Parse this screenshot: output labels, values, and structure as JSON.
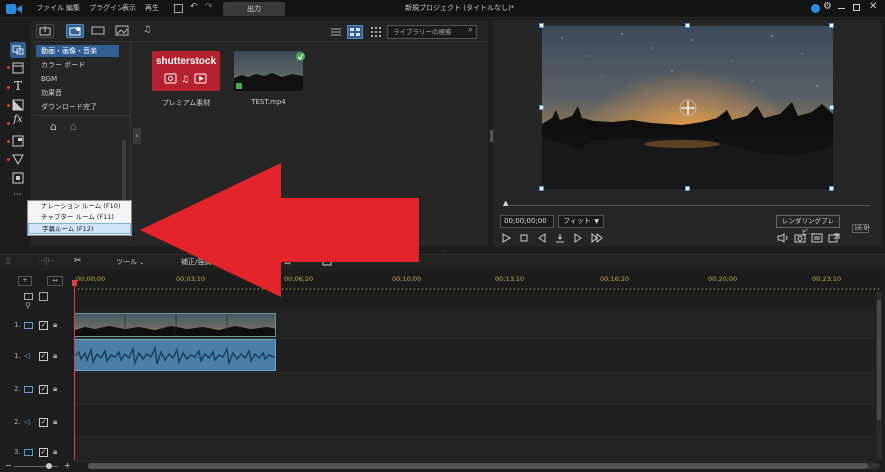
{
  "menubar": {
    "items": [
      "ファイル",
      "編集",
      "プラグイン",
      "表示",
      "再生"
    ],
    "export_tab": "出力",
    "window_title": "新規プロジェクト (タイトルなし)*"
  },
  "library": {
    "search_placeholder": "ライブラリーの検索",
    "categories": [
      "動画・画像・音楽",
      "カラー ボード",
      "BGM",
      "効果音",
      "ダウンロード完了"
    ],
    "selected_category": "動画・画像・音楽",
    "media": [
      {
        "logo": "shutterstock",
        "caption": "プレミアム素材"
      },
      {
        "caption": "TEST.mp4"
      }
    ]
  },
  "room_menu": {
    "items": [
      "ナレーション ルーム (F10)",
      "チャプター ルーム (F11)",
      "字幕ルーム (F12)"
    ],
    "selected": "字幕ルーム (F12)"
  },
  "preview": {
    "timecode": "00;00;00;00",
    "fit": "フィット",
    "render_button": "レンダリングプレビ...",
    "aspect": "16:9"
  },
  "timeline": {
    "toolbar": {
      "tools": "ツール",
      "correction": "補正/強調",
      "partial": "ム"
    },
    "ruler_labels": [
      "00;00;00",
      "00;03;10",
      "00;06;20",
      "00;10;00",
      "00;13;10",
      "00;16;20",
      "00;20;00",
      "00;23;10"
    ],
    "tracks": [
      "1.",
      "1.",
      "2.",
      "2.",
      "3."
    ]
  },
  "colors": {
    "accent_blue": "#2f5f93",
    "arrow_red": "#e3242b",
    "shutterstock_red": "#b3222e",
    "ruler_gold": "#c8a84a",
    "playhead": "#e04040"
  }
}
